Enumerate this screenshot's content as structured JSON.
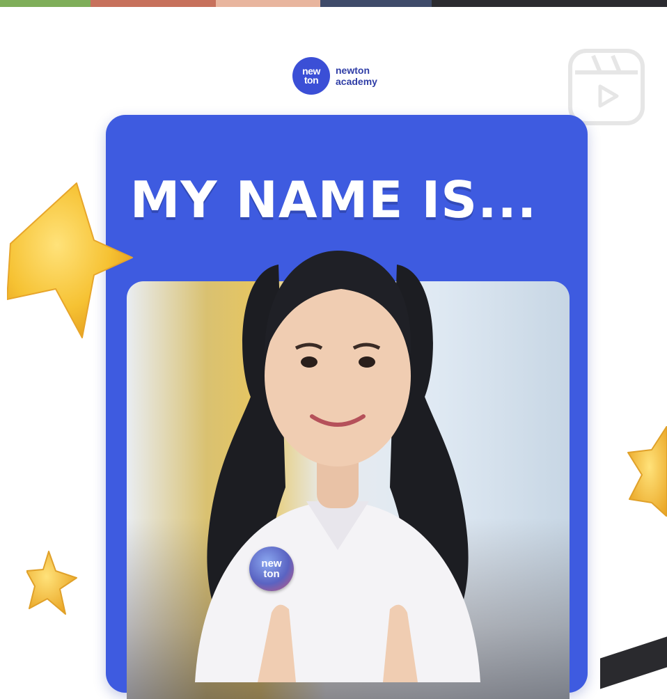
{
  "logo": {
    "badge_line1": "new",
    "badge_line2": "ton",
    "line1": "newton",
    "line2": "academy"
  },
  "card": {
    "title": "MY NAME IS..."
  },
  "pin": {
    "line1": "new",
    "line2": "ton"
  },
  "icons": {
    "reels": "reels-icon",
    "star": "star-icon"
  },
  "colors": {
    "brand_blue": "#3e5be0",
    "star_yellow": "#f6c233"
  }
}
